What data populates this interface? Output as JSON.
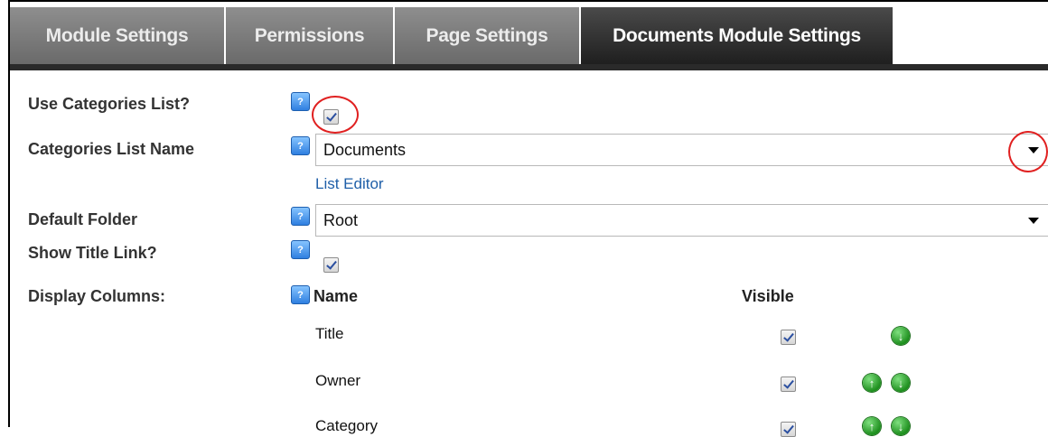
{
  "tabs": [
    {
      "label": "Module Settings"
    },
    {
      "label": "Permissions"
    },
    {
      "label": "Page Settings"
    },
    {
      "label": "Documents Module Settings"
    }
  ],
  "form": {
    "use_categories_label": "Use Categories List?",
    "use_categories_checked": true,
    "categories_list_name_label": "Categories List Name",
    "categories_list_value": "Documents",
    "list_editor_link": "List Editor",
    "default_folder_label": "Default Folder",
    "default_folder_value": "Root",
    "show_title_link_label": "Show Title Link?",
    "show_title_link_checked": true,
    "display_columns_label": "Display Columns:"
  },
  "columns_table": {
    "headers": {
      "name": "Name",
      "visible": "Visible"
    },
    "rows": [
      {
        "name": "Title",
        "visible": true,
        "can_move_up": false,
        "can_move_down": true
      },
      {
        "name": "Owner",
        "visible": true,
        "can_move_up": true,
        "can_move_down": true
      },
      {
        "name": "Category",
        "visible": true,
        "can_move_up": true,
        "can_move_down": true
      }
    ]
  },
  "icons": {
    "help": "help-icon",
    "move_up": "arrow-up-icon",
    "move_down": "arrow-down-icon",
    "dropdown": "caret-down-icon"
  },
  "colors": {
    "tab_inactive": "#6f6f6f",
    "tab_active": "#222222",
    "link": "#1f5fa8",
    "highlight_circle": "#e02020",
    "arrow_green": "#1e8f1e"
  }
}
